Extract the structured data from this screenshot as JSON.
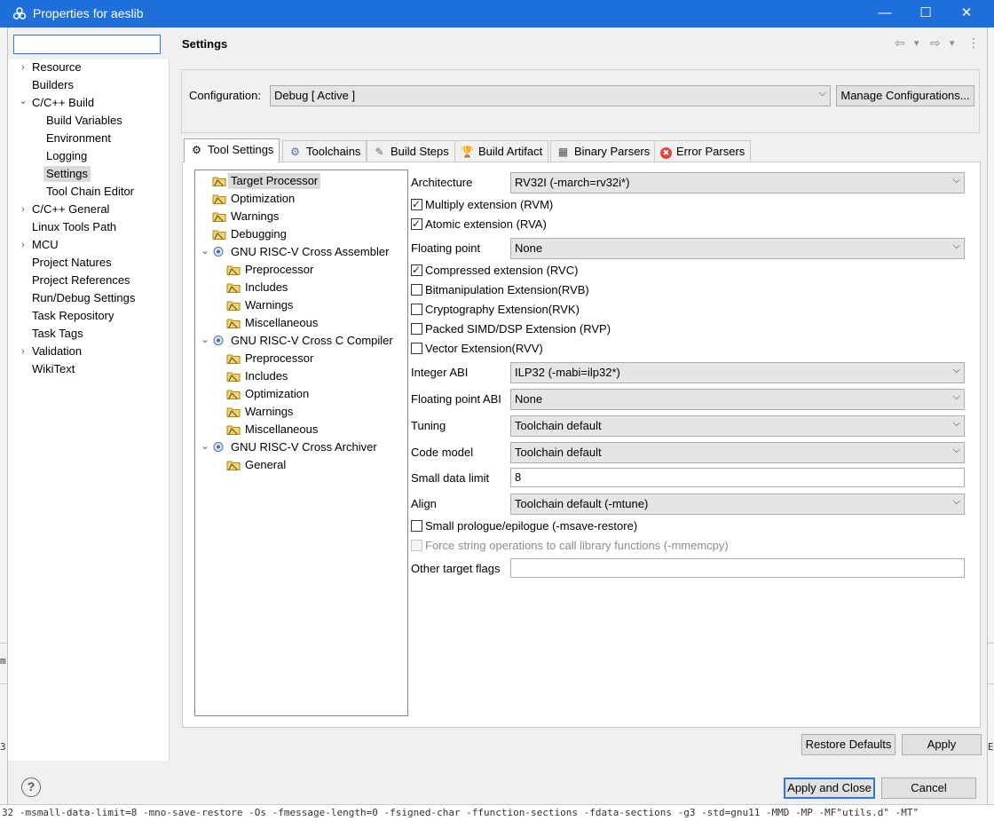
{
  "window": {
    "title": "Properties for aeslib",
    "minimize_icon": "—",
    "maximize_icon": "☐",
    "close_icon": "✕"
  },
  "filter_input": {
    "value": ""
  },
  "left_tree": [
    {
      "label": "Resource",
      "expander": "›"
    },
    {
      "label": "Builders"
    },
    {
      "label": "C/C++ Build",
      "expander": "⌄"
    },
    {
      "label": "Build Variables"
    },
    {
      "label": "Environment"
    },
    {
      "label": "Logging"
    },
    {
      "label": "Settings",
      "selected": true
    },
    {
      "label": "Tool Chain Editor"
    },
    {
      "label": "C/C++ General",
      "expander": "›"
    },
    {
      "label": "Linux Tools Path"
    },
    {
      "label": "MCU",
      "expander": "›"
    },
    {
      "label": "Project Natures"
    },
    {
      "label": "Project References"
    },
    {
      "label": "Run/Debug Settings"
    },
    {
      "label": "Task Repository"
    },
    {
      "label": "Task Tags"
    },
    {
      "label": "Validation",
      "expander": "›"
    },
    {
      "label": "WikiText"
    }
  ],
  "page_title": "Settings",
  "nav": {
    "back_icon": "⇦",
    "forward_icon": "⇨",
    "dropdown_icon": "▾",
    "menu_icon": "⋮"
  },
  "configuration": {
    "label": "Configuration:",
    "value": "Debug  [ Active ]",
    "manage_button": "Manage Configurations..."
  },
  "tabs": [
    {
      "label": "Tool Settings",
      "icon": "⚙",
      "active": true
    },
    {
      "label": "Toolchains",
      "icon": "⚙"
    },
    {
      "label": "Build Steps",
      "icon": "✎"
    },
    {
      "label": "Build Artifact",
      "icon": "🏆"
    },
    {
      "label": "Binary Parsers",
      "icon": "▦"
    },
    {
      "label": "Error Parsers",
      "icon": "✖"
    }
  ],
  "option_tree": [
    {
      "label": "Target Processor",
      "selected": true
    },
    {
      "label": "Optimization"
    },
    {
      "label": "Warnings"
    },
    {
      "label": "Debugging"
    },
    {
      "label": "GNU RISC-V Cross Assembler",
      "expander": "⌄"
    },
    {
      "label": "Preprocessor"
    },
    {
      "label": "Includes"
    },
    {
      "label": "Warnings"
    },
    {
      "label": "Miscellaneous"
    },
    {
      "label": "GNU RISC-V Cross C Compiler",
      "expander": "⌄"
    },
    {
      "label": "Preprocessor"
    },
    {
      "label": "Includes"
    },
    {
      "label": "Optimization"
    },
    {
      "label": "Warnings"
    },
    {
      "label": "Miscellaneous"
    },
    {
      "label": "GNU RISC-V Cross Archiver",
      "expander": "⌄"
    },
    {
      "label": "General"
    }
  ],
  "settings": {
    "architecture": {
      "label": "Architecture",
      "value": "RV32I (-march=rv32i*)"
    },
    "multiply": {
      "label": "Multiply extension (RVM)",
      "checked": true
    },
    "atomic": {
      "label": "Atomic extension (RVA)",
      "checked": true
    },
    "floating_point": {
      "label": "Floating point",
      "value": "None"
    },
    "compressed": {
      "label": "Compressed extension (RVC)",
      "checked": true
    },
    "bitmanip": {
      "label": "Bitmanipulation Extension(RVB)",
      "checked": false
    },
    "crypto": {
      "label": "Cryptography Extension(RVK)",
      "checked": false
    },
    "simd": {
      "label": "Packed SIMD/DSP Extension (RVP)",
      "checked": false
    },
    "vector": {
      "label": "Vector Extension(RVV)",
      "checked": false
    },
    "integer_abi": {
      "label": "Integer ABI",
      "value": "ILP32 (-mabi=ilp32*)"
    },
    "fp_abi": {
      "label": "Floating point ABI",
      "value": "None"
    },
    "tuning": {
      "label": "Tuning",
      "value": "Toolchain default"
    },
    "code_model": {
      "label": "Code model",
      "value": "Toolchain default"
    },
    "small_data": {
      "label": "Small data limit",
      "value": "8"
    },
    "align": {
      "label": "Align",
      "value": "Toolchain default (-mtune)"
    },
    "small_prologue": {
      "label": "Small prologue/epilogue (-msave-restore)",
      "checked": false
    },
    "force_string": {
      "label": "Force string operations to call library functions (-mmemcpy)",
      "checked": false,
      "disabled": true
    },
    "other_flags": {
      "label": "Other target flags",
      "value": ""
    }
  },
  "buttons": {
    "restore_defaults": "Restore Defaults",
    "apply": "Apply",
    "apply_close": "Apply and Close",
    "cancel": "Cancel",
    "help_icon": "?"
  },
  "background": {
    "console_line": "32 -msmall-data-limit=8 -mno-save-restore -Os -fmessage-length=0 -fsigned-char -ffunction-sections -fdata-sections  -g3 -std=gnu11 -MMD -MP -MF\"utils.d\" -MT\"",
    "left_fragment_1": "m",
    "left_fragment_2": "3",
    "right_fragment": "E"
  }
}
